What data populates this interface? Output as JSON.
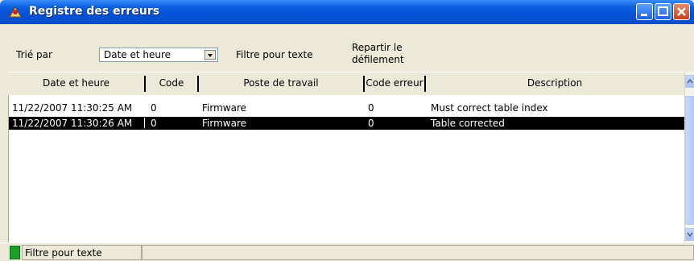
{
  "window": {
    "title": "Registre des erreurs",
    "accent": "#0550D6"
  },
  "toolbar": {
    "sort_label": "Trié par",
    "sort_value": "Date et heure",
    "filter_label": "Filtre pour texte",
    "scroll_label_line1": "Repartir le",
    "scroll_label_line2": "défilement"
  },
  "table": {
    "columns": [
      "Date et heure",
      "Code",
      "Poste de travail",
      "Code erreur",
      "Description"
    ],
    "rows": [
      {
        "date": "11/22/2007 11:30:25 AM",
        "code": "0",
        "poste": "Firmware",
        "code_erreur": "0",
        "description": "Must correct table index",
        "selected": false
      },
      {
        "date": "11/22/2007 11:30:26 AM",
        "code": "0",
        "poste": "Firmware",
        "code_erreur": "0",
        "description": "Table corrected",
        "selected": true
      }
    ]
  },
  "status": {
    "text": "Filtre pour texte",
    "indicator_color": "#1E9E2A"
  }
}
